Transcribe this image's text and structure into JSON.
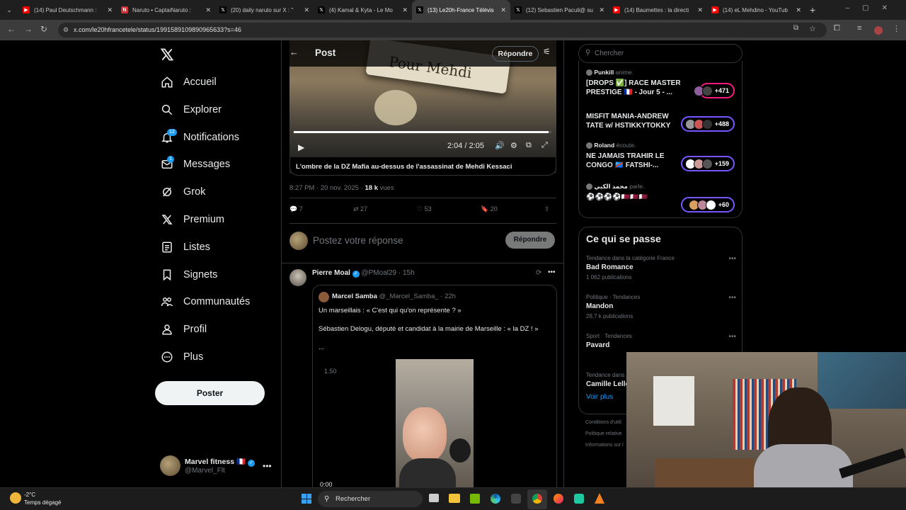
{
  "browser": {
    "tabs": [
      {
        "title": "(14) Paul Deutschmann : ",
        "fav": "yt"
      },
      {
        "title": "Naruto • CaptaiNaruto :",
        "fav": "nt"
      },
      {
        "title": "(20) daily naruto sur X : \"",
        "fav": "x"
      },
      {
        "title": "(4) Kamal & Kyta - Le Mo",
        "fav": "x"
      },
      {
        "title": "(13) Le20h-France Télévis",
        "fav": "x",
        "active": true
      },
      {
        "title": "(12) Sebastien Paculi@ su",
        "fav": "x"
      },
      {
        "title": "(14) Baumettes : la directi",
        "fav": "yt"
      },
      {
        "title": "(14) eL Mehdino - YouTub",
        "fav": "yt"
      }
    ],
    "url": "x.com/le20hfrancetele/status/1991589109890965633?s=46"
  },
  "nav": {
    "items": [
      {
        "label": "Accueil",
        "icon": "home-icon"
      },
      {
        "label": "Explorer",
        "icon": "search-icon"
      },
      {
        "label": "Notifications",
        "icon": "bell-icon",
        "badge": "12"
      },
      {
        "label": "Messages",
        "icon": "mail-icon",
        "badge": "1"
      },
      {
        "label": "Grok",
        "icon": "grok-icon"
      },
      {
        "label": "Premium",
        "icon": "x-logo-icon"
      },
      {
        "label": "Listes",
        "icon": "list-icon"
      },
      {
        "label": "Signets",
        "icon": "bookmark-icon"
      },
      {
        "label": "Communautés",
        "icon": "people-icon"
      },
      {
        "label": "Profil",
        "icon": "person-icon"
      },
      {
        "label": "Plus",
        "icon": "more-circle-icon"
      }
    ],
    "post_button": "Poster",
    "account": {
      "name": "Marvel fitness 🇫🇷",
      "handle": "@Marvel_Flt"
    }
  },
  "post": {
    "header": "Post",
    "reply_button": "Répondre",
    "video_overlay_text": "Pour Mehdi",
    "video_time": "2:04 / 2:05",
    "video_progress": 0.99,
    "video_caption": "L'ombre de la DZ Mafia au-dessus de l'assassinat de Mehdi Kessaci",
    "timestamp": "8:27 PM · 20 nov. 2025 · ",
    "views_count": "18 k",
    "views_label": "vues",
    "stats": {
      "replies": "7",
      "reposts": "27",
      "likes": "53",
      "bookmarks": "20"
    },
    "reply_placeholder": "Postez votre réponse",
    "reply_submit": "Répondre"
  },
  "reply": {
    "name": "Pierre Moal",
    "handle": "@PMoal29 · 15h",
    "quoted": {
      "name": "Marcel Samba",
      "handle": "@_Marcel_Samba_ · 22h",
      "line1": "Un marseillais : « C'est qui qu'on représente ? »",
      "line2": "Sébastien Delogu, député et candidat à la mairie de Marseille : « la DZ ! »",
      "ellipsis": "...",
      "speed": "1.50",
      "time": "0:00"
    }
  },
  "search": {
    "placeholder": "Chercher"
  },
  "spaces": [
    {
      "host": "Punkill",
      "action": "anime.",
      "title": "[DROPS ✅] RACE MASTER PRESTIGE 🇫🇷 - Jour 5 - ...",
      "count": "+471",
      "color": "#f91880"
    },
    {
      "host": "",
      "action": "",
      "title": "MISFIT MANIA-ANDREW TATE w/ HSTIKKYTOKKY",
      "count": "+488",
      "color": "#7856ff"
    },
    {
      "host": "Roland",
      "action": "écoute.",
      "title": "NE JAMAIS TRAHIR LE CONGO 🇨🇩 FATSHI-...",
      "count": "+159",
      "color": "#7856ff"
    },
    {
      "host": "محمد الكبي",
      "action": "parle.",
      "title": "⚽⚽⚽⚽🇶🇦🇶🇦🇶🇦",
      "count": "+60",
      "color": "#7856ff"
    }
  ],
  "trends": {
    "title": "Ce qui se passe",
    "items": [
      {
        "context": "Tendance dans la catégorie France",
        "name": "Bad Romance",
        "count": "1 062 publications"
      },
      {
        "context": "Politique · Tendances",
        "name": "Mandon",
        "count": "28,7 k publications"
      },
      {
        "context": "Sport · Tendances",
        "name": "Pavard",
        "count": ""
      },
      {
        "context": "Tendance dans",
        "name": "Camille Lelle",
        "count": ""
      }
    ],
    "more": "Voir plus"
  },
  "footer": [
    "Conditions d'utili",
    "Politique relative",
    "Informations sur l"
  ],
  "taskbar": {
    "temp": "-2°C",
    "weather": "Temps dégagé",
    "search": "Rechercher"
  }
}
